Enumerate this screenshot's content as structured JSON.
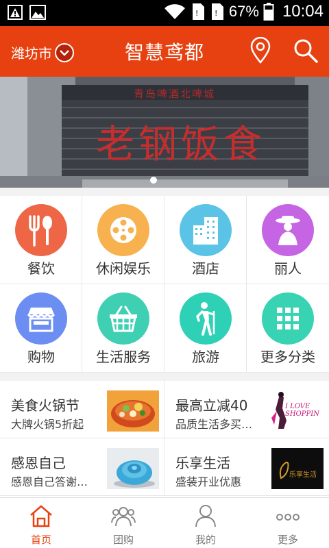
{
  "status_bar": {
    "battery": "67%",
    "time": "10:04",
    "icons": [
      "warning-icon",
      "image-icon",
      "wifi-icon",
      "sim-icon",
      "sim-icon",
      "battery-icon"
    ]
  },
  "header": {
    "city": "潍坊市",
    "title": "智慧鸢都",
    "icons": [
      "chevron-down-icon",
      "location-pin-icon",
      "search-icon"
    ]
  },
  "banner": {
    "sign_top": "青岛啤酒北啤城",
    "sign_main": "老钢饭食",
    "page_count": 2,
    "active_page": 0
  },
  "categories": [
    {
      "label": "餐饮",
      "icon": "fork-spoon-icon",
      "color": "#ef6647"
    },
    {
      "label": "休闲娱乐",
      "icon": "film-reel-icon",
      "color": "#f7b24f"
    },
    {
      "label": "酒店",
      "icon": "buildings-icon",
      "color": "#5ac3e6"
    },
    {
      "label": "丽人",
      "icon": "lady-hat-icon",
      "color": "#c565e3"
    },
    {
      "label": "购物",
      "icon": "storefront-icon",
      "color": "#6c8df1"
    },
    {
      "label": "生活服务",
      "icon": "basket-icon",
      "color": "#3fd0b4"
    },
    {
      "label": "旅游",
      "icon": "hiker-icon",
      "color": "#2ed1b6"
    },
    {
      "label": "更多分类",
      "icon": "grid-icon",
      "color": "#38d3b3"
    }
  ],
  "promos": [
    {
      "title": "美食火锅节",
      "subtitle": "大牌火锅5折起"
    },
    {
      "title": "最高立减40",
      "subtitle": "品质生活多买…",
      "image_text": "I LOVE SHOPPING"
    },
    {
      "title": "感恩自己",
      "subtitle": "感恩自己答谢…"
    },
    {
      "title": "乐享生活",
      "subtitle": "盛装开业优惠",
      "image_text": "乐享生活"
    }
  ],
  "tabs": [
    {
      "label": "首页",
      "icon": "home-icon",
      "active": true
    },
    {
      "label": "团购",
      "icon": "group-icon",
      "active": false
    },
    {
      "label": "我的",
      "icon": "person-icon",
      "active": false
    },
    {
      "label": "更多",
      "icon": "more-dots-icon",
      "active": false
    }
  ],
  "colors": {
    "accent": "#e84111",
    "status_bar": "#000000"
  }
}
